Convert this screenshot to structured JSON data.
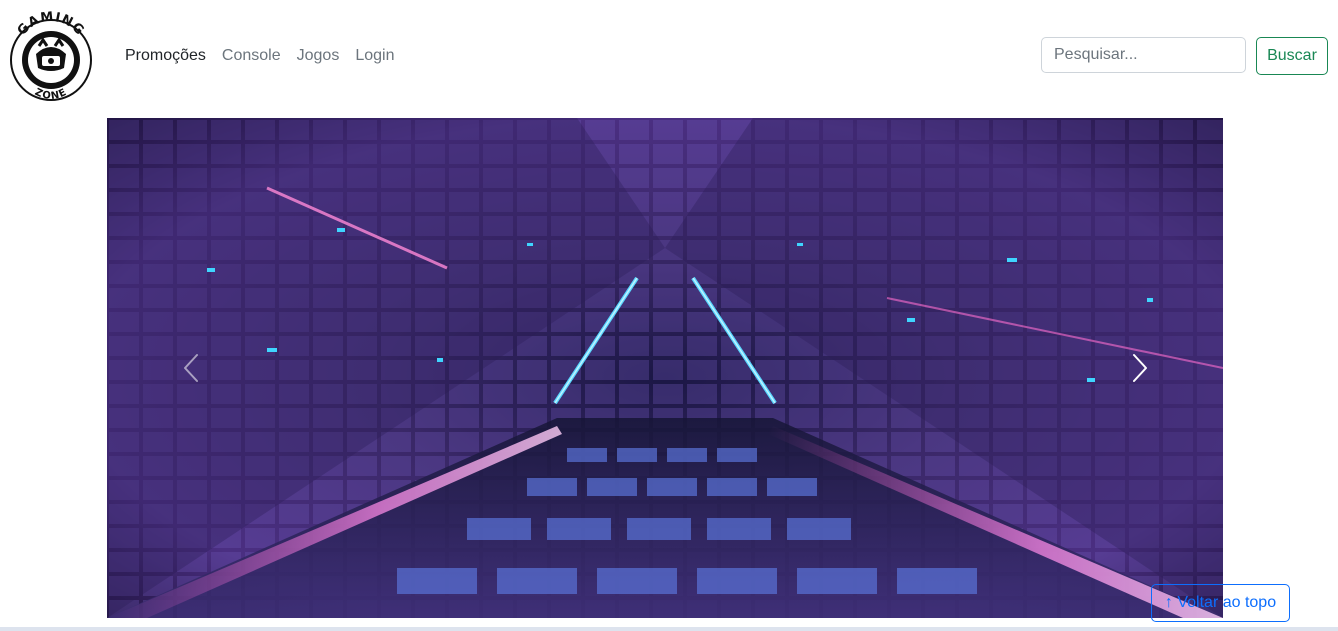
{
  "brand": {
    "logo_top_text": "GAMING",
    "logo_bottom_text": "ZONE"
  },
  "nav": {
    "items": [
      {
        "label": "Promoções",
        "active": true
      },
      {
        "label": "Console",
        "active": false
      },
      {
        "label": "Jogos",
        "active": false
      },
      {
        "label": "Login",
        "active": false
      }
    ]
  },
  "search": {
    "placeholder": "Pesquisar...",
    "value": "",
    "button_label": "Buscar"
  },
  "carousel": {
    "prev_icon": "chevron-left-icon",
    "next_icon": "chevron-right-icon"
  },
  "back_to_top": {
    "label": "↑ Voltar ao topo"
  },
  "colors": {
    "success": "#198754",
    "primary": "#0d6efd",
    "nav_muted": "#6c757d",
    "nav_active": "#212529"
  }
}
